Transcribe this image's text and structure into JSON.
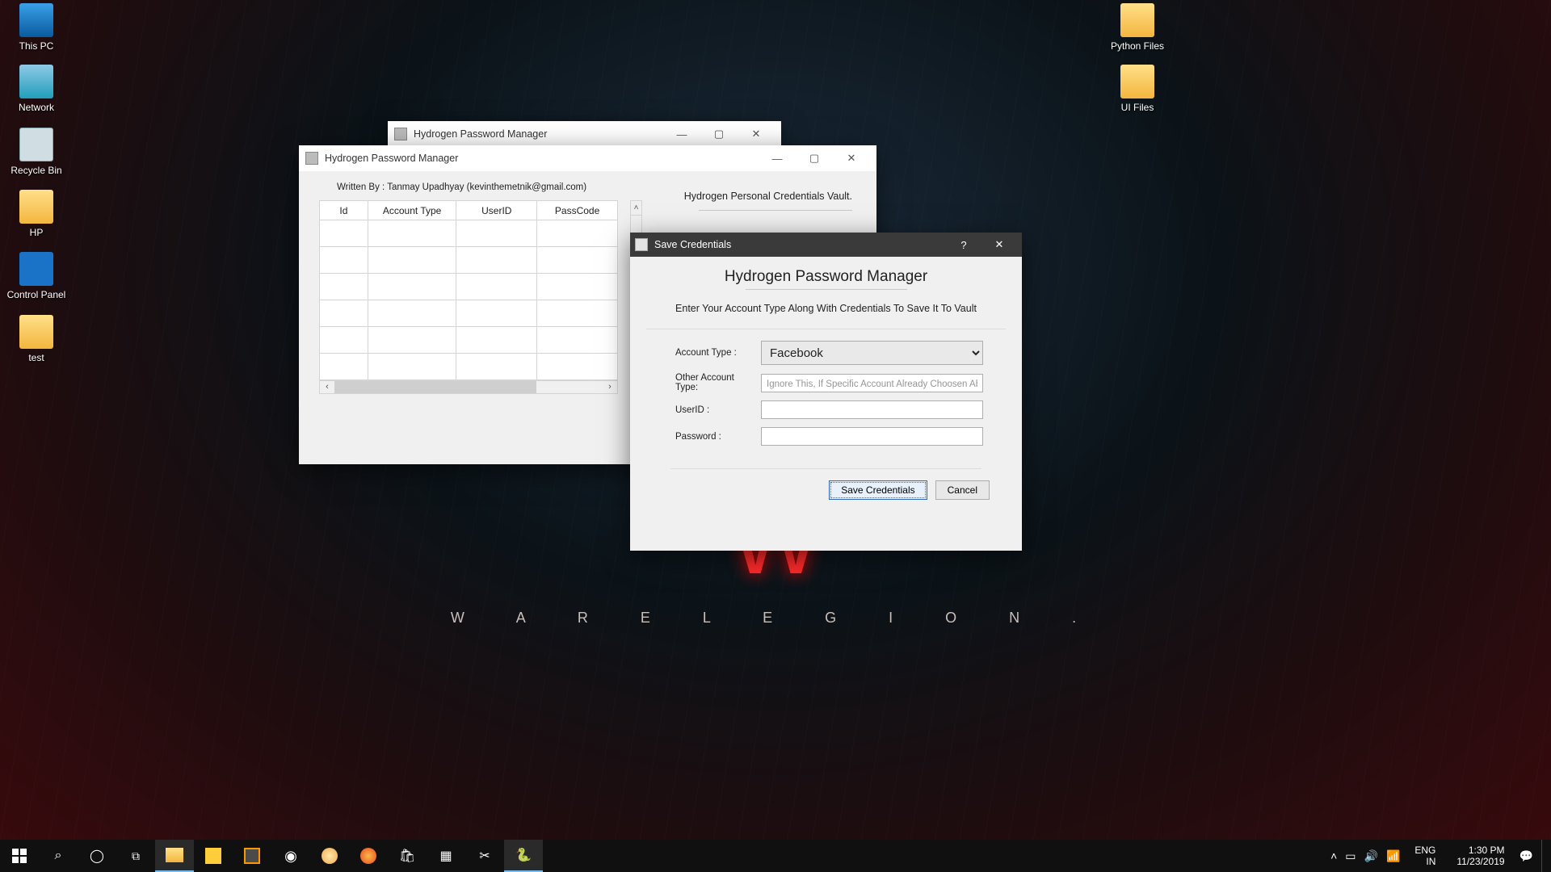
{
  "desktop": {
    "icons_left": [
      {
        "label": "This PC",
        "cls": "ico-pc"
      },
      {
        "label": "Network",
        "cls": "ico-net"
      },
      {
        "label": "Recycle Bin",
        "cls": "ico-bin"
      },
      {
        "label": "HP",
        "cls": "ico-folder"
      },
      {
        "label": "Control Panel",
        "cls": "ico-cpanel"
      },
      {
        "label": "test",
        "cls": "ico-folder"
      }
    ],
    "icons_right": [
      {
        "label": "Python Files",
        "cls": "ico-folder"
      },
      {
        "label": "UI Files",
        "cls": "ico-folder"
      }
    ],
    "wallpaper_text": "W   A R E   L E G I O N ."
  },
  "bgwin": {
    "title": "Hydrogen Password Manager"
  },
  "mainwin": {
    "title": "Hydrogen Password Manager",
    "written_by": "Written By : Tanmay Upadhyay (kevinthemetnik@gmail.com)",
    "vault_title": "Hydrogen Personal Credentials Vault.",
    "columns": [
      "Id",
      "Account Type",
      "UserID",
      "PassCode"
    ],
    "rows": 6
  },
  "dialog": {
    "title": "Save Credentials",
    "heading": "Hydrogen Password Manager",
    "subheading": "Enter Your Account Type Along With Credentials To Save It To Vault",
    "labels": {
      "account_type": "Account Type  :",
      "other": "Other Account Type:",
      "userid": "UserID  :",
      "password": "Password   :"
    },
    "account_type_value": "Facebook",
    "other_placeholder": "Ignore This, If Specific Account Already Choosen Above.",
    "userid_value": "",
    "password_value": "",
    "primary": "Save Credentials",
    "secondary": "Cancel"
  },
  "taskbar": {
    "lang": "ENG",
    "region": "IN",
    "time": "1:30 PM",
    "date": "11/23/2019"
  }
}
